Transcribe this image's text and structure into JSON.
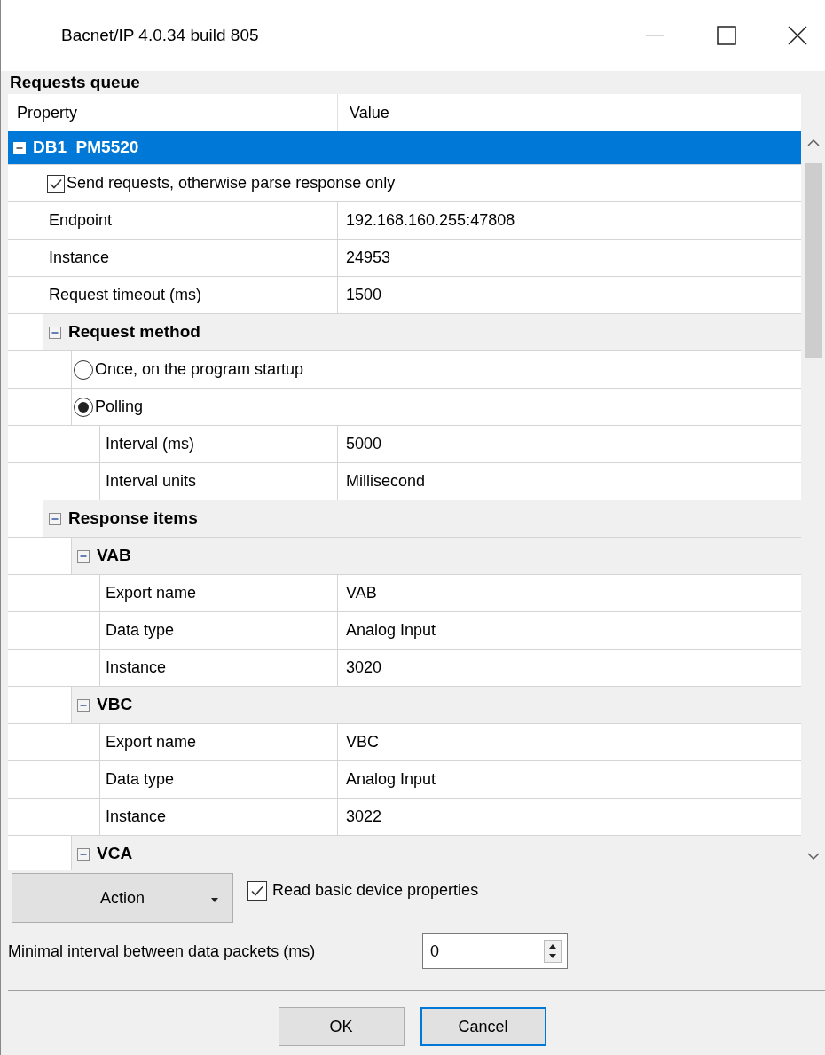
{
  "window": {
    "title": "Bacnet/IP 4.0.34 build 805"
  },
  "panel_title": "Requests queue",
  "grid": {
    "columns": [
      "Property",
      "Value"
    ],
    "tree": [
      {
        "kind": "group",
        "label": "DB1_PM5520",
        "expanded": true,
        "selected": true,
        "children": [
          {
            "kind": "checkbox",
            "label": "Send requests, otherwise parse response only",
            "checked": true
          },
          {
            "kind": "property",
            "name": "Endpoint",
            "value": "192.168.160.255:47808"
          },
          {
            "kind": "property",
            "name": "Instance",
            "value": "24953"
          },
          {
            "kind": "property",
            "name": "Request timeout (ms)",
            "value": "1500"
          },
          {
            "kind": "group",
            "label": "Request method",
            "expanded": true,
            "selected": false,
            "children": [
              {
                "kind": "radio",
                "label": "Once, on the program startup",
                "selected": false
              },
              {
                "kind": "radio",
                "label": "Polling",
                "selected": true,
                "children": [
                  {
                    "kind": "property",
                    "name": "Interval (ms)",
                    "value": "5000"
                  },
                  {
                    "kind": "property",
                    "name": "Interval units",
                    "value": "Millisecond"
                  }
                ]
              }
            ]
          },
          {
            "kind": "group",
            "label": "Response items",
            "expanded": true,
            "selected": false,
            "children": [
              {
                "kind": "group",
                "label": "VAB",
                "expanded": true,
                "selected": false,
                "children": [
                  {
                    "kind": "property",
                    "name": "Export name",
                    "value": "VAB"
                  },
                  {
                    "kind": "property",
                    "name": "Data type",
                    "value": "Analog Input"
                  },
                  {
                    "kind": "property",
                    "name": "Instance",
                    "value": "3020"
                  }
                ]
              },
              {
                "kind": "group",
                "label": "VBC",
                "expanded": true,
                "selected": false,
                "children": [
                  {
                    "kind": "property",
                    "name": "Export name",
                    "value": "VBC"
                  },
                  {
                    "kind": "property",
                    "name": "Data type",
                    "value": "Analog Input"
                  },
                  {
                    "kind": "property",
                    "name": "Instance",
                    "value": "3022"
                  }
                ]
              },
              {
                "kind": "group",
                "label": "VCA",
                "expanded": true,
                "selected": false
              }
            ]
          }
        ]
      }
    ]
  },
  "action_button": {
    "label": "Action"
  },
  "read_basic": {
    "label": "Read basic device properties",
    "checked": true
  },
  "min_interval": {
    "label": "Minimal interval between data packets (ms)",
    "value": "0"
  },
  "buttons": [
    {
      "label": "OK",
      "focused": false
    },
    {
      "label": "Cancel",
      "focused": true
    }
  ]
}
